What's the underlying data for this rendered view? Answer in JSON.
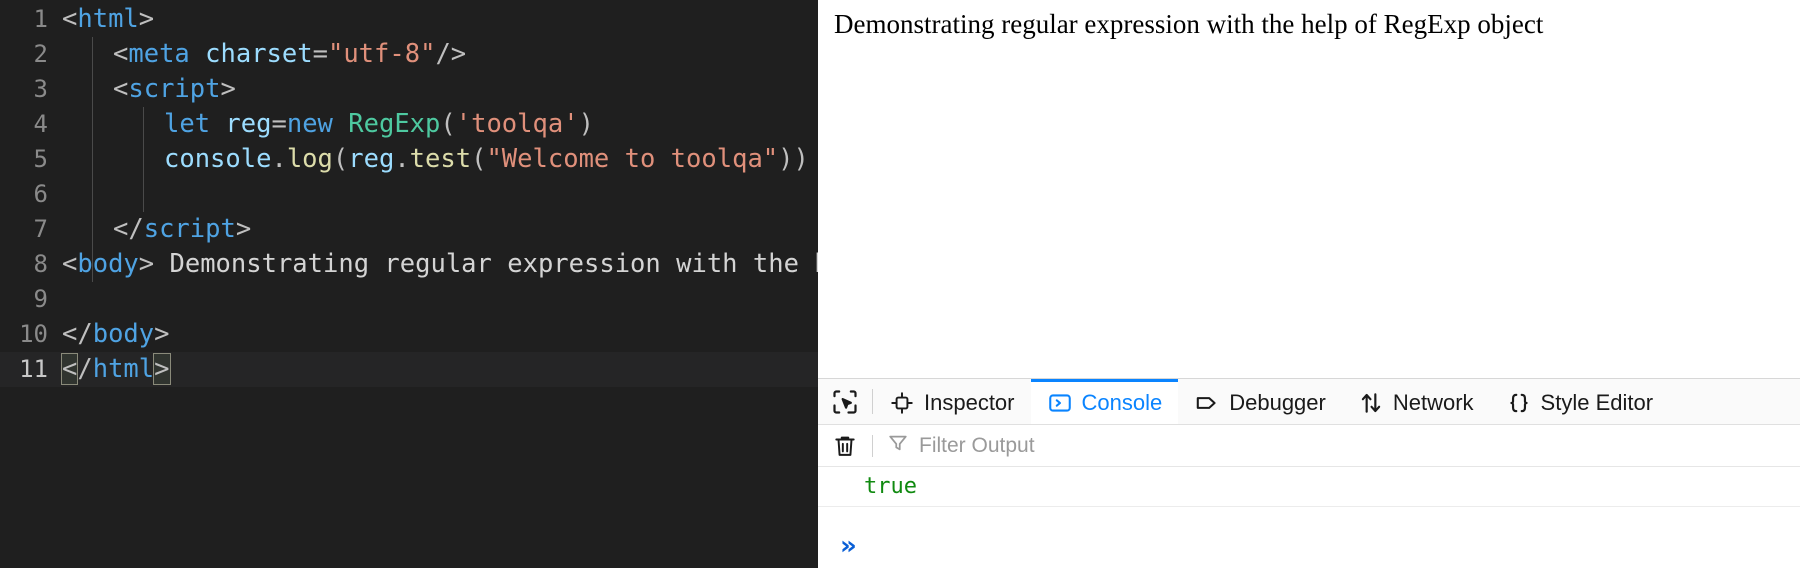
{
  "editor": {
    "lines": [
      {
        "num": "1",
        "tokens": [
          {
            "t": "<",
            "c": "t-punct"
          },
          {
            "t": "html",
            "c": "t-tag"
          },
          {
            "t": ">",
            "c": "t-punct"
          }
        ],
        "indent": 0
      },
      {
        "num": "2",
        "tokens": [
          {
            "t": "<",
            "c": "t-punct"
          },
          {
            "t": "meta",
            "c": "t-tag"
          },
          {
            "t": " ",
            "c": "t-plain"
          },
          {
            "t": "charset",
            "c": "t-attr"
          },
          {
            "t": "=",
            "c": "t-punct"
          },
          {
            "t": "\"utf-8\"",
            "c": "t-str"
          },
          {
            "t": "/>",
            "c": "t-punct"
          }
        ],
        "indent": 2
      },
      {
        "num": "3",
        "tokens": [
          {
            "t": "<",
            "c": "t-punct"
          },
          {
            "t": "script",
            "c": "t-tag"
          },
          {
            "t": ">",
            "c": "t-punct"
          }
        ],
        "indent": 2
      },
      {
        "num": "4",
        "tokens": [
          {
            "t": "let",
            "c": "t-kw"
          },
          {
            "t": " ",
            "c": "t-plain"
          },
          {
            "t": "reg",
            "c": "t-var"
          },
          {
            "t": "=",
            "c": "t-punct"
          },
          {
            "t": "new",
            "c": "t-kw"
          },
          {
            "t": " ",
            "c": "t-plain"
          },
          {
            "t": "RegExp",
            "c": "t-class"
          },
          {
            "t": "(",
            "c": "t-punct"
          },
          {
            "t": "'toolqa'",
            "c": "t-str"
          },
          {
            "t": ")",
            "c": "t-punct"
          }
        ],
        "indent": 4
      },
      {
        "num": "5",
        "tokens": [
          {
            "t": "console",
            "c": "t-var"
          },
          {
            "t": ".",
            "c": "t-punct"
          },
          {
            "t": "log",
            "c": "t-fn"
          },
          {
            "t": "(",
            "c": "t-punct"
          },
          {
            "t": "reg",
            "c": "t-var"
          },
          {
            "t": ".",
            "c": "t-punct"
          },
          {
            "t": "test",
            "c": "t-fn"
          },
          {
            "t": "(",
            "c": "t-punct"
          },
          {
            "t": "\"Welcome to toolqa\"",
            "c": "t-str"
          },
          {
            "t": "))",
            "c": "t-punct"
          }
        ],
        "indent": 4
      },
      {
        "num": "6",
        "tokens": [],
        "indent": 0
      },
      {
        "num": "7",
        "tokens": [
          {
            "t": "</",
            "c": "t-punct"
          },
          {
            "t": "script",
            "c": "t-tag"
          },
          {
            "t": ">",
            "c": "t-punct"
          }
        ],
        "indent": 2
      },
      {
        "num": "8",
        "tokens": [
          {
            "t": "<",
            "c": "t-punct"
          },
          {
            "t": "body",
            "c": "t-tag"
          },
          {
            "t": ">",
            "c": "t-punct"
          },
          {
            "t": " Demonstrating regular expression with the help",
            "c": "t-text"
          }
        ],
        "indent": 0
      },
      {
        "num": "9",
        "tokens": [],
        "indent": 0
      },
      {
        "num": "10",
        "tokens": [
          {
            "t": "</",
            "c": "t-punct"
          },
          {
            "t": "body",
            "c": "t-tag"
          },
          {
            "t": ">",
            "c": "t-punct"
          }
        ],
        "indent": 0
      },
      {
        "num": "11",
        "tokens": [
          {
            "t": "<",
            "c": "t-punct bracket-match"
          },
          {
            "t": "/",
            "c": "t-punct"
          },
          {
            "t": "html",
            "c": "t-tag"
          },
          {
            "t": ">",
            "c": "t-punct bracket-match"
          }
        ],
        "indent": 0,
        "active": true
      }
    ]
  },
  "browser": {
    "page_text": "Demonstrating regular expression with the help of RegExp object"
  },
  "devtools": {
    "picker_icon": "element-picker-icon",
    "tabs": [
      {
        "label": "Inspector",
        "icon": "inspector-icon",
        "active": false
      },
      {
        "label": "Console",
        "icon": "console-icon",
        "active": true
      },
      {
        "label": "Debugger",
        "icon": "debugger-icon",
        "active": false
      },
      {
        "label": "Network",
        "icon": "network-icon",
        "active": false
      },
      {
        "label": "Style Editor",
        "icon": "style-editor-icon",
        "active": false
      }
    ],
    "console": {
      "clear_icon": "trash-icon",
      "filter_icon": "funnel-icon",
      "filter_placeholder": "Filter Output",
      "filter_value": "",
      "messages": [
        {
          "text": "true",
          "kind": "result"
        }
      ],
      "prompt_symbol": "»",
      "prompt_value": ""
    }
  },
  "colors": {
    "accent_blue": "#0a84ff",
    "prompt_blue": "#0a5fd6",
    "result_green": "#108a10",
    "editor_bg": "#1f1f1f",
    "gutter_fg": "#8a8a8a"
  }
}
